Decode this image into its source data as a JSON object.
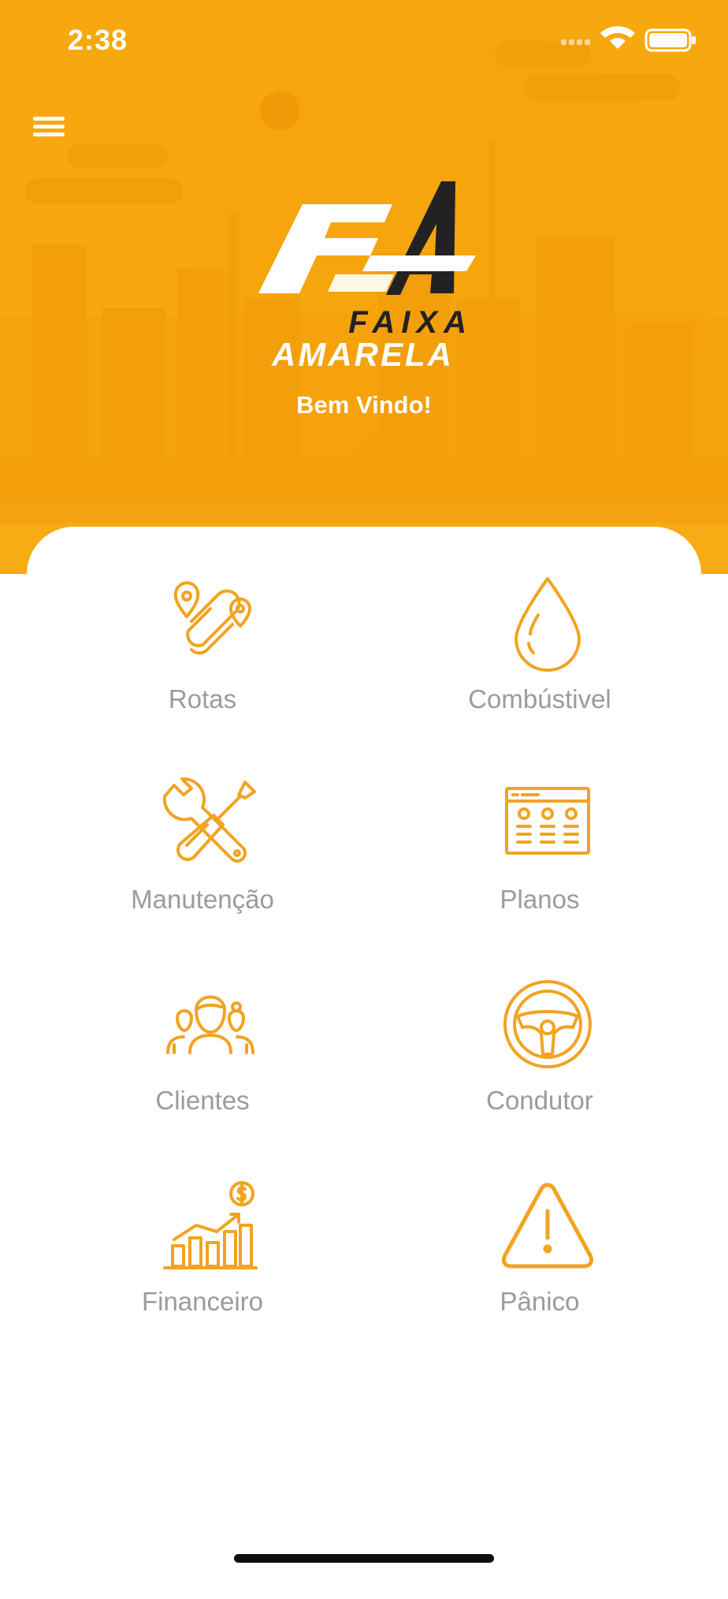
{
  "status_bar": {
    "time": "2:38"
  },
  "header": {
    "brand_line1": "FAIXA",
    "brand_line2": "AMARELA",
    "welcome": "Bem Vindo!"
  },
  "colors": {
    "brand_yellow": "#f7a80e",
    "icon_orange": "#f2a321",
    "label_gray": "#9b9b9b",
    "logo_dark": "#222222"
  },
  "menu": [
    {
      "label": "Rotas",
      "icon": "route-icon"
    },
    {
      "label": "Combústivel",
      "icon": "fuel-drop-icon"
    },
    {
      "label": "Manutenção",
      "icon": "tools-icon"
    },
    {
      "label": "Planos",
      "icon": "plans-browser-icon"
    },
    {
      "label": "Clientes",
      "icon": "clients-group-icon"
    },
    {
      "label": "Condutor",
      "icon": "steering-wheel-icon"
    },
    {
      "label": "Financeiro",
      "icon": "finance-chart-icon"
    },
    {
      "label": "Pânico",
      "icon": "warning-icon"
    }
  ]
}
